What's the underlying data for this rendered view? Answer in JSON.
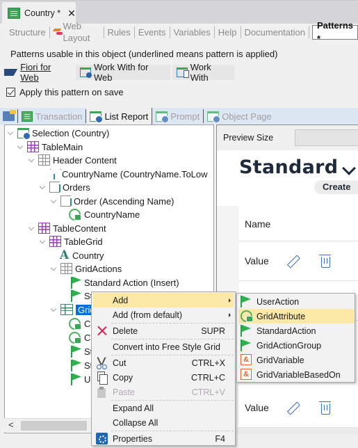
{
  "document_tab": {
    "title": "Country *",
    "close": "✕"
  },
  "editor_tabs": [
    {
      "label": "Structure",
      "icon": null,
      "active": false
    },
    {
      "label": "Web Layout",
      "icon": "web-layout-icon",
      "active": false
    },
    {
      "label": "Rules",
      "icon": null,
      "active": false
    },
    {
      "label": "Events",
      "icon": null,
      "active": false
    },
    {
      "label": "Variables",
      "icon": null,
      "active": false
    },
    {
      "label": "Help",
      "icon": null,
      "active": false
    },
    {
      "label": "Documentation",
      "icon": null,
      "active": false
    },
    {
      "label": "Patterns *",
      "icon": null,
      "active": true
    }
  ],
  "patterns": {
    "description": "Patterns usable in this object (underlined means pattern is applied)",
    "tabs": [
      {
        "label": "Fiori for Web",
        "active": true,
        "applied": true
      },
      {
        "label": "Work With for Web",
        "active": false,
        "applied": false
      },
      {
        "label": "Work With",
        "active": false,
        "applied": false
      }
    ],
    "apply_on_save": {
      "label": "Apply this pattern on save",
      "checked": true
    }
  },
  "instance_tabs": [
    {
      "label": "Transaction",
      "enabled": false
    },
    {
      "label": "List Report",
      "enabled": true,
      "active": true
    },
    {
      "label": "Prompt",
      "enabled": false
    },
    {
      "label": "Object Page",
      "enabled": false
    }
  ],
  "tree": {
    "nodes": [
      {
        "label": "Selection (Country)",
        "icon": "web-panel-icon",
        "level": 0,
        "expanded": true
      },
      {
        "label": "TableMain",
        "icon": "table-icon",
        "level": 1,
        "expanded": true
      },
      {
        "label": "Header Content",
        "icon": "grid-gray-icon",
        "level": 2,
        "expanded": true
      },
      {
        "label": "CountryName (CountryName.ToLow",
        "icon": "filter-icon",
        "level": 3
      },
      {
        "label": "Orders",
        "icon": "orders-icon",
        "level": 3,
        "expanded": true
      },
      {
        "label": "Order (Ascending Name)",
        "icon": "order-icon",
        "level": 4,
        "expanded": true
      },
      {
        "label": "CountryName",
        "icon": "attribute-icon",
        "level": 5
      },
      {
        "label": "TableContent",
        "icon": "table-icon",
        "level": 1,
        "expanded": true
      },
      {
        "label": "TableGrid",
        "icon": "table-icon",
        "level": 2,
        "expanded": true
      },
      {
        "label": "Country",
        "icon": "text-icon",
        "level": 3
      },
      {
        "label": "GridActions",
        "icon": "grid-gray-icon",
        "level": 3,
        "expanded": true
      },
      {
        "label": "Standard Action (Insert)",
        "icon": "flag-icon",
        "level": 4
      },
      {
        "label": "St",
        "icon": "flag-icon",
        "level": 4
      },
      {
        "label": "Grid",
        "icon": "grid-icon",
        "level": 3,
        "expanded": true,
        "selected": true
      },
      {
        "label": "Co",
        "icon": "attribute-icon",
        "level": 4
      },
      {
        "label": "Co",
        "icon": "attribute-icon",
        "level": 4
      },
      {
        "label": "St",
        "icon": "flag-icon",
        "level": 4
      },
      {
        "label": "St",
        "icon": "flag-icon",
        "level": 4
      },
      {
        "label": "Us",
        "icon": "flag-icon",
        "level": 4
      }
    ],
    "scroll_left": "<"
  },
  "preview": {
    "size_label": "Preview Size",
    "title": "Standard",
    "create_label": "Create",
    "table_header": "Name",
    "rows": [
      "Value",
      "Value",
      "Value"
    ]
  },
  "context_menu": {
    "items": [
      {
        "label": "Add",
        "shortcut": "",
        "submenu": true,
        "hover": true
      },
      {
        "label": "Add (from default)",
        "shortcut": "",
        "submenu": true
      },
      {
        "label": "Delete",
        "shortcut": "SUPR",
        "icon": "delete-icon"
      },
      {
        "label": "Convert into Free Style Grid",
        "shortcut": ""
      },
      {
        "label": "Cut",
        "shortcut": "CTRL+X",
        "icon": "cut-icon"
      },
      {
        "label": "Copy",
        "shortcut": "CTRL+C",
        "icon": "copy-icon"
      },
      {
        "label": "Paste",
        "shortcut": "CTRL+V",
        "icon": "paste-icon",
        "disabled": true
      },
      {
        "label": "Expand All",
        "shortcut": ""
      },
      {
        "label": "Collapse All",
        "shortcut": ""
      },
      {
        "label": "Properties",
        "shortcut": "F4",
        "icon": "gear-icon"
      }
    ]
  },
  "sub_menu": {
    "items": [
      {
        "label": "UserAction",
        "icon": "flag-icon"
      },
      {
        "label": "GridAttribute",
        "icon": "attribute-icon",
        "hover": true
      },
      {
        "label": "StandardAction",
        "icon": "flag-icon"
      },
      {
        "label": "GridActionGroup",
        "icon": "flag-icon"
      },
      {
        "label": "GridVariable",
        "icon": "variable-icon"
      },
      {
        "label": "GridVariableBasedOn",
        "icon": "variable-icon"
      }
    ],
    "variable_glyph": "&"
  },
  "colors": {
    "selection": "#0a6fd6",
    "menu_hover": "#fce8a7",
    "instance_tab_bar": "#dde6f3",
    "flag_green": "#2fb04f",
    "preview_icon_blue": "#3d6fb8"
  }
}
